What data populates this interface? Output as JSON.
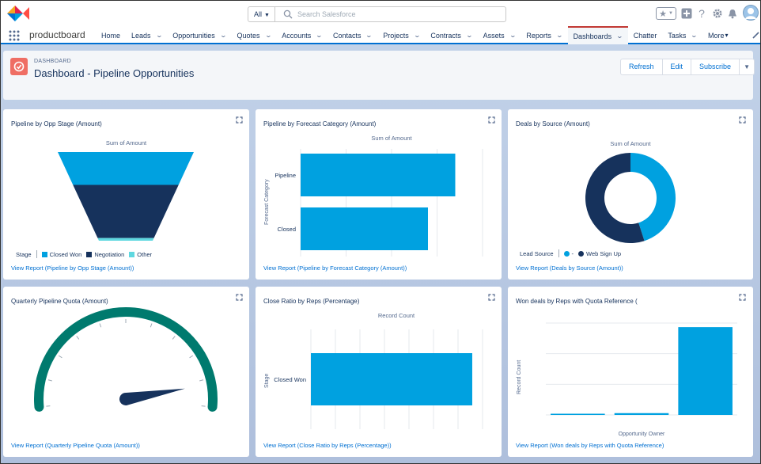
{
  "header": {
    "search": {
      "scope": "All",
      "placeholder": "Search Salesforce"
    },
    "icons": [
      "favorites-star-icon",
      "add-icon",
      "help-icon",
      "settings-gear-icon",
      "notifications-bell-icon",
      "avatar"
    ]
  },
  "navbar": {
    "app_name": "productboard",
    "items": [
      {
        "label": "Home",
        "has_menu": false
      },
      {
        "label": "Leads",
        "has_menu": true
      },
      {
        "label": "Opportunities",
        "has_menu": true
      },
      {
        "label": "Quotes",
        "has_menu": true
      },
      {
        "label": "Accounts",
        "has_menu": true
      },
      {
        "label": "Contacts",
        "has_menu": true
      },
      {
        "label": "Projects",
        "has_menu": true
      },
      {
        "label": "Contracts",
        "has_menu": true
      },
      {
        "label": "Assets",
        "has_menu": true
      },
      {
        "label": "Reports",
        "has_menu": true
      },
      {
        "label": "Dashboards",
        "has_menu": true,
        "active": true
      },
      {
        "label": "Chatter",
        "has_menu": false
      },
      {
        "label": "Tasks",
        "has_menu": true
      },
      {
        "label": "More",
        "has_menu": true
      }
    ]
  },
  "dashboard": {
    "kicker": "DASHBOARD",
    "title": "Dashboard - Pipeline Opportunities",
    "buttons": {
      "refresh": "Refresh",
      "edit": "Edit",
      "subscribe": "Subscribe"
    }
  },
  "colors": {
    "accent": "#0070d2",
    "bar": "#00a1e0",
    "navy": "#16325c",
    "teal_light": "#5fd8e0",
    "gauge": "#007a6e",
    "dash_icon": "#ef6e64",
    "active_tab": "#c23934"
  },
  "cards": [
    {
      "title": "Pipeline by Opp Stage (Amount)",
      "subtitle": "Sum of Amount",
      "link": "View Report (Pipeline by Opp Stage (Amount))",
      "legend_title": "Stage",
      "chart_data": {
        "type": "funnel",
        "series": [
          {
            "name": "Closed Won",
            "color": "#00a1e0",
            "share": 0.37
          },
          {
            "name": "Negotiation",
            "color": "#16325c",
            "share": 0.6
          },
          {
            "name": "Other",
            "color": "#5fd8e0",
            "share": 0.03
          }
        ]
      }
    },
    {
      "title": "Pipeline by Forecast Category (Amount)",
      "subtitle": "Sum of Amount",
      "link": "View Report (Pipeline by Forecast Category (Amount))",
      "ylabel": "Forecast Category",
      "chart_data": {
        "type": "bar",
        "orientation": "horizontal",
        "categories": [
          "Pipeline",
          "Closed"
        ],
        "values": [
          0.85,
          0.7
        ],
        "xlim": [
          0,
          1
        ]
      }
    },
    {
      "title": "Deals by Source (Amount)",
      "subtitle": "Sum of Amount",
      "link": "View Report (Deals by Source (Amount))",
      "legend_title": "Lead Source",
      "chart_data": {
        "type": "pie",
        "donut": true,
        "series": [
          {
            "name": "-",
            "color": "#00a1e0",
            "share": 0.45
          },
          {
            "name": "Web Sign Up",
            "color": "#16325c",
            "share": 0.55
          }
        ]
      }
    },
    {
      "title": "Quarterly Pipeline Quota (Amount)",
      "link": "View Report (Quarterly Pipeline Quota (Amount))",
      "chart_data": {
        "type": "gauge",
        "needle_fraction": 0.92,
        "ticks": 11
      }
    },
    {
      "title": "Close Ratio by Reps (Percentage)",
      "subtitle": "Record Count",
      "link": "View Report (Close Ratio by Reps (Percentage))",
      "ylabel": "Stage",
      "chart_data": {
        "type": "bar",
        "orientation": "horizontal",
        "categories": [
          "Closed Won"
        ],
        "values": [
          0.94
        ],
        "xlim": [
          0,
          1
        ]
      }
    },
    {
      "title": "Won deals by Reps with Quota Reference (",
      "link": "View Report (Won deals by Reps with Quota Reference)",
      "ylabel": "Record Count",
      "xlabel": "Opportunity Owner",
      "chart_data": {
        "type": "bar",
        "orientation": "vertical",
        "values": [
          0.01,
          0.02,
          0.99
        ],
        "ylim": [
          0,
          1
        ]
      }
    }
  ]
}
